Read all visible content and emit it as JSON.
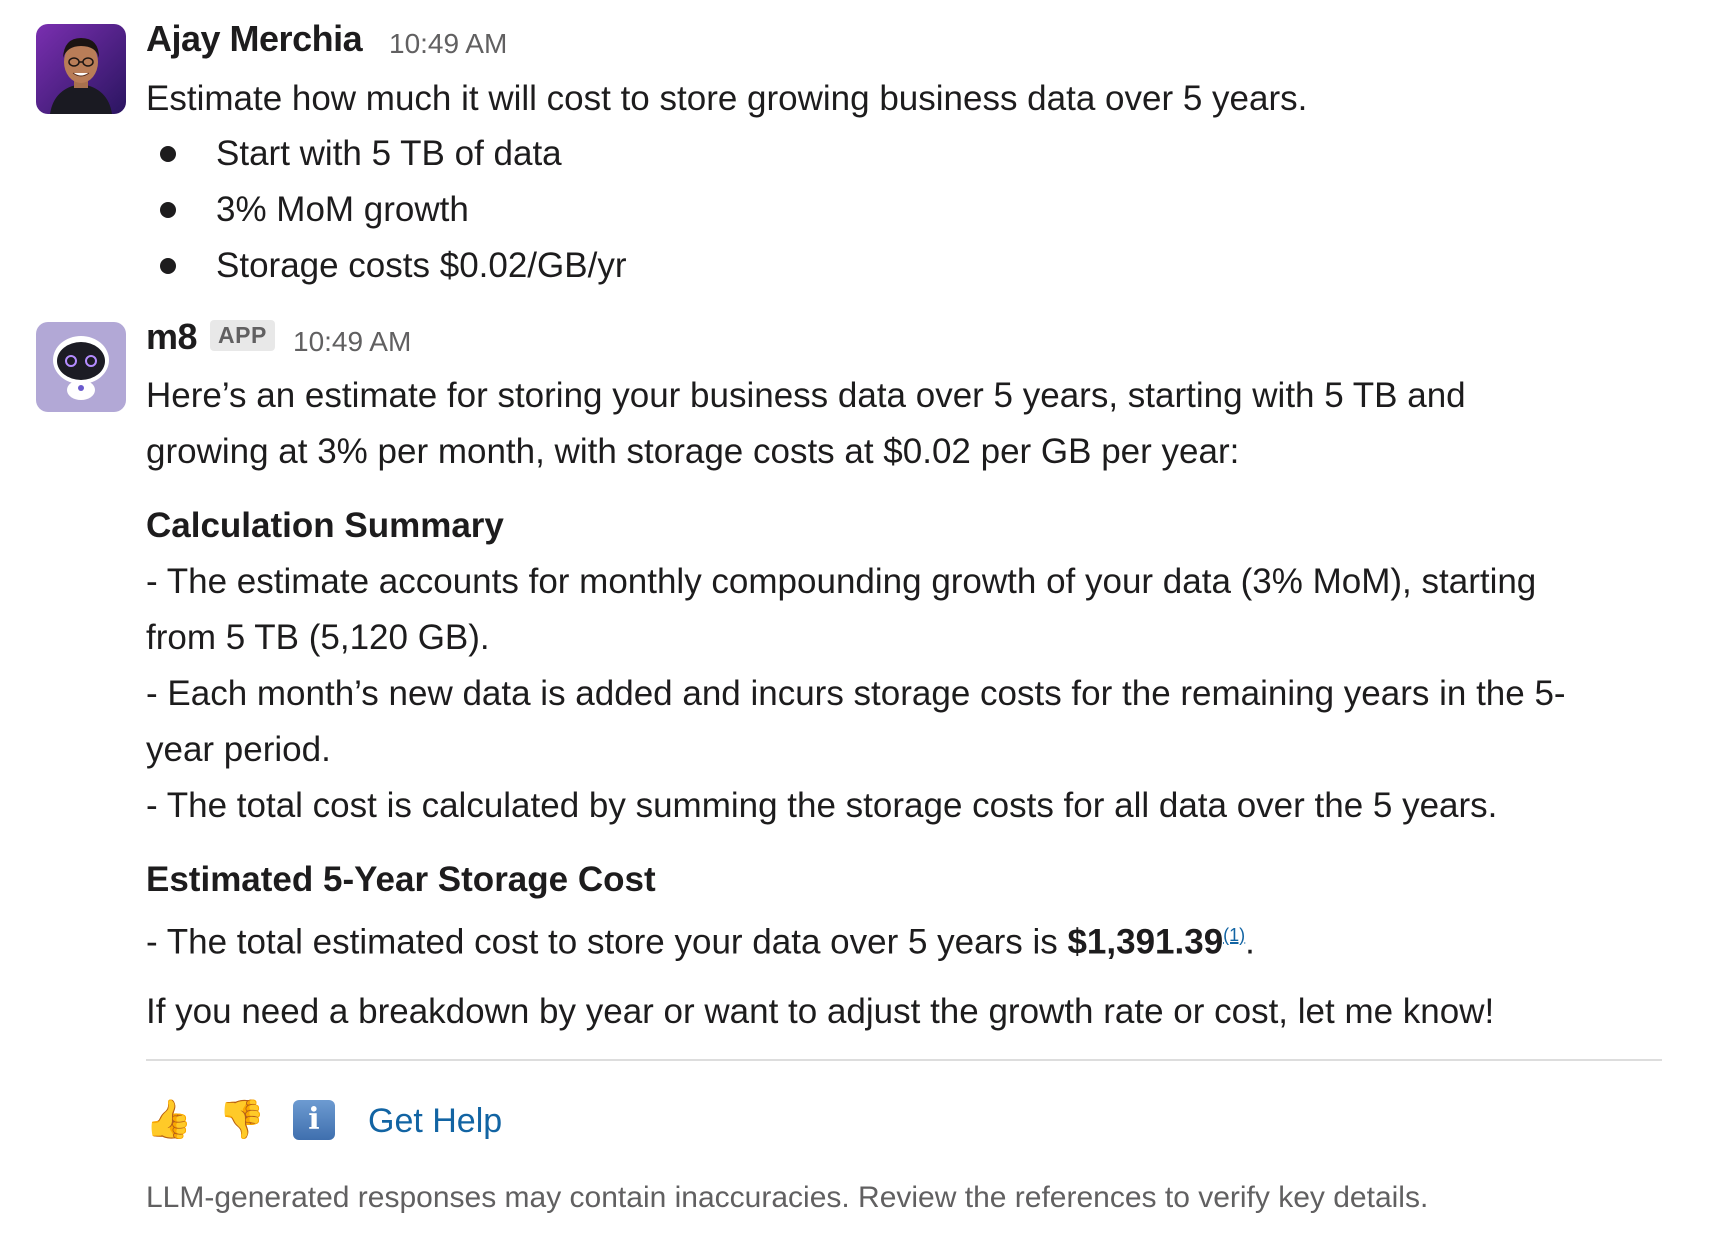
{
  "messages": [
    {
      "author": "Ajay Merchia",
      "time": "10:49 AM",
      "body": "Estimate how much it will cost to store growing business data over 5 years.",
      "bullets": [
        "Start with 5 TB of data",
        "3% MoM growth",
        "Storage costs $0.02/GB/yr"
      ]
    },
    {
      "author": "m8",
      "badge": "APP",
      "time": "10:49 AM",
      "intro_line1": "Here’s an estimate for storing your business data over 5 years, starting with 5 TB and",
      "intro_line2": "growing at 3% per month, with storage costs at $0.02 per GB per year:",
      "heading1": "Calculation Summary",
      "summary_lines": [
        "- The estimate accounts for monthly compounding growth of your data (3% MoM), starting",
        "from 5 TB (5,120 GB).",
        "- Each month’s new data is added and incurs storage costs for the remaining years in the 5-",
        "year period.",
        "- The total cost is calculated by summing the storage costs for all data over the 5 years."
      ],
      "heading2": "Estimated 5-Year Storage Cost",
      "cost_prefix": "- The total estimated cost to store your data over 5 years is ",
      "cost_value": "$1,391.39",
      "cost_ref": "(1)",
      "cost_suffix": ".",
      "closing": "If you need a breakdown by year or want to adjust the growth rate or cost, let me know!"
    }
  ],
  "actions": {
    "thumbs_up": "👍",
    "thumbs_down": "👎",
    "info": "i",
    "get_help": "Get Help"
  },
  "disclaimer": "LLM-generated responses may contain inaccuracies. Review the references to verify key details.",
  "colors": {
    "link": "#1264a3",
    "muted": "#616061",
    "text": "#1d1c1d"
  }
}
